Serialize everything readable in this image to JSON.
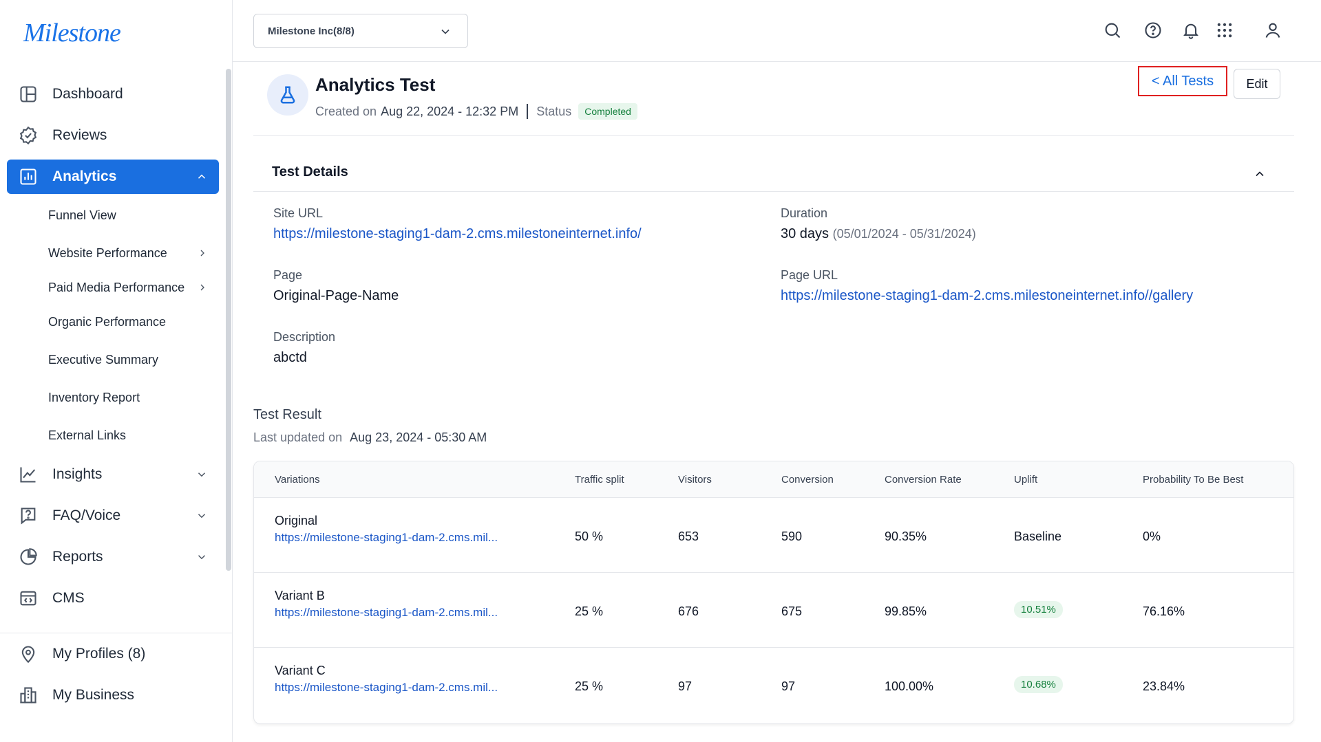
{
  "app": {
    "logo": "Milestone"
  },
  "sidebar": {
    "items": [
      {
        "label": "Dashboard",
        "icon": "dashboard-icon"
      },
      {
        "label": "Reviews",
        "icon": "reviews-icon"
      },
      {
        "label": "Analytics",
        "icon": "analytics-icon",
        "active": true
      },
      {
        "label": "Insights",
        "icon": "insights-icon"
      },
      {
        "label": "FAQ/Voice",
        "icon": "faq-icon"
      },
      {
        "label": "Reports",
        "icon": "reports-icon"
      },
      {
        "label": "CMS",
        "icon": "cms-icon"
      }
    ],
    "analytics_sub": [
      {
        "label": "Funnel View"
      },
      {
        "label": "Website Performance"
      },
      {
        "label": "Paid Media Performance"
      },
      {
        "label": "Organic Performance"
      },
      {
        "label": "Executive Summary"
      },
      {
        "label": "Inventory Report"
      },
      {
        "label": "External Links"
      }
    ],
    "bottom": [
      {
        "label": "My Profiles (8)",
        "icon": "location-pin-icon"
      },
      {
        "label": "My Business",
        "icon": "business-icon"
      }
    ]
  },
  "header": {
    "org_select": "Milestone Inc(8/8)",
    "icons": [
      "search-icon",
      "help-icon",
      "bell-icon",
      "apps-grid-icon",
      "user-icon"
    ]
  },
  "test": {
    "title": "Analytics Test",
    "created_label": "Created on",
    "created_value": "Aug 22, 2024 - 12:32 PM",
    "status_label": "Status",
    "status_value": "Completed",
    "all_tests": "< All Tests",
    "edit": "Edit"
  },
  "details": {
    "title": "Test Details",
    "site_url_label": "Site URL",
    "site_url": "https://milestone-staging1-dam-2.cms.milestoneinternet.info/",
    "duration_label": "Duration",
    "duration_value": "30 days",
    "duration_range": "(05/01/2024 - 05/31/2024)",
    "page_label": "Page",
    "page_value": "Original-Page-Name",
    "page_url_label": "Page URL",
    "page_url": "https://milestone-staging1-dam-2.cms.milestoneinternet.info//gallery",
    "description_label": "Description",
    "description_value": "abctd"
  },
  "result": {
    "title": "Test Result",
    "updated_label": "Last updated on",
    "updated_value": "Aug 23, 2024 - 05:30 AM",
    "columns": [
      "Variations",
      "Traffic split",
      "Visitors",
      "Conversion",
      "Conversion Rate",
      "Uplift",
      "Probability To Be Best"
    ],
    "rows": [
      {
        "name": "Original",
        "url": "https://milestone-staging1-dam-2.cms.mil...",
        "traffic": "50 %",
        "visitors": "653",
        "conversion": "590",
        "rate": "90.35%",
        "uplift": "Baseline",
        "uplift_badge": false,
        "probability": "0%"
      },
      {
        "name": "Variant B",
        "url": "https://milestone-staging1-dam-2.cms.mil...",
        "traffic": "25 %",
        "visitors": "676",
        "conversion": "675",
        "rate": "99.85%",
        "uplift": "10.51%",
        "uplift_badge": true,
        "probability": "76.16%"
      },
      {
        "name": "Variant C",
        "url": "https://milestone-staging1-dam-2.cms.mil...",
        "traffic": "25 %",
        "visitors": "97",
        "conversion": "97",
        "rate": "100.00%",
        "uplift": "10.68%",
        "uplift_badge": true,
        "probability": "23.84%"
      }
    ]
  }
}
